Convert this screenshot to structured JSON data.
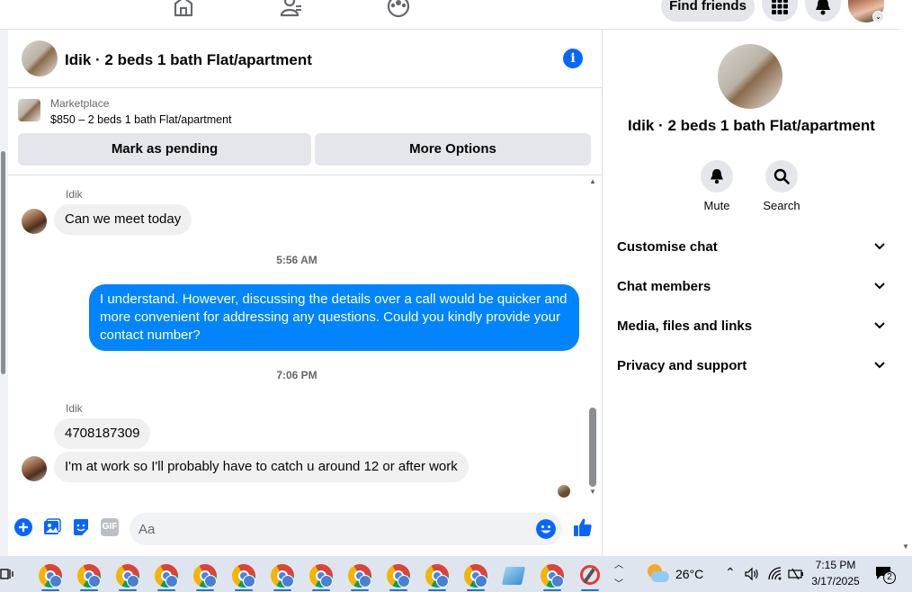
{
  "topnav": {
    "find_friends": "Find friends",
    "icons": [
      "home-icon",
      "friends-icon",
      "groups-icon",
      "menu-grid-icon",
      "notifications-icon"
    ]
  },
  "chat": {
    "title": "Idik · 2 beds 1 bath Flat/apartment",
    "marketplace": {
      "label": "Marketplace",
      "listing": "$850 – 2 beds 1 bath Flat/apartment",
      "mark_pending": "Mark as pending",
      "more_options": "More Options"
    },
    "messages": [
      {
        "sender": "Idik",
        "text": "Can we meet today",
        "direction": "in"
      },
      {
        "timestamp": "5:56 AM"
      },
      {
        "text": "I understand. However, discussing the details over a call would be quicker and more convenient for addressing any questions. Could you kindly provide your contact number?",
        "direction": "out"
      },
      {
        "timestamp": "7:06 PM"
      },
      {
        "sender": "Idik",
        "text": "4708187309",
        "direction": "in"
      },
      {
        "text": "I'm at work so I'll probably have to catch u around 12 or after work",
        "direction": "in"
      }
    ],
    "composer": {
      "placeholder": "Aa",
      "value": "",
      "icons": [
        "plus-icon",
        "photo-icon",
        "sticker-icon",
        "gif-icon",
        "emoji-icon",
        "thumbs-up-icon"
      ],
      "gif_label": "GIF"
    }
  },
  "details": {
    "title": "Idik · 2 beds 1 bath Flat/apartment",
    "actions": [
      {
        "label": "Mute",
        "icon": "bell-icon"
      },
      {
        "label": "Search",
        "icon": "search-icon"
      }
    ],
    "sections": [
      "Customise chat",
      "Chat members",
      "Media, files and links",
      "Privacy and support"
    ]
  },
  "taskbar": {
    "weather": "26°C",
    "time": "7:15 PM",
    "date": "3/17/2025",
    "notification_count": "2",
    "chrome_count": 13
  },
  "colors": {
    "accent": "#0866ff",
    "outgoing_bubble": "#0084ff",
    "incoming_bubble": "#f0f0f0",
    "button_grey": "#e4e6eb"
  }
}
